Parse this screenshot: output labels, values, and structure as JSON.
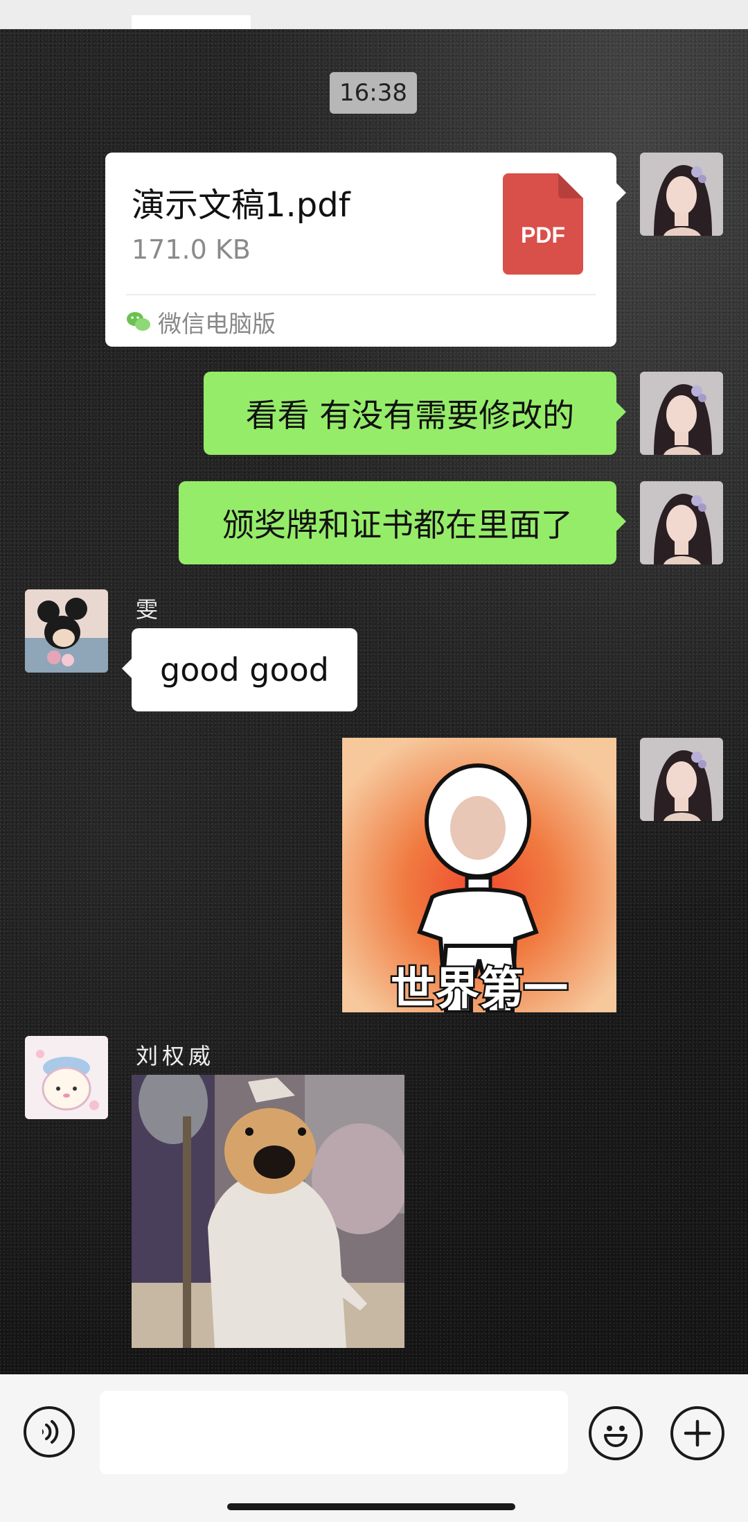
{
  "timestamp": "16:38",
  "file_message": {
    "name": "演示文稿1.pdf",
    "size": "171.0 KB",
    "icon_label": "PDF",
    "source": "微信电脑版"
  },
  "messages": {
    "msg1": "看看 有没有需要修改的",
    "msg2": "颁奖牌和证书都在里面了",
    "reply1_sender": "雯",
    "reply1_text": "good good",
    "sticker1_caption": "世界第一",
    "reply2_sender": "刘权威"
  },
  "colors": {
    "my_bubble": "#95ec69",
    "other_bubble": "#ffffff",
    "pdf_red": "#d94f4a"
  }
}
